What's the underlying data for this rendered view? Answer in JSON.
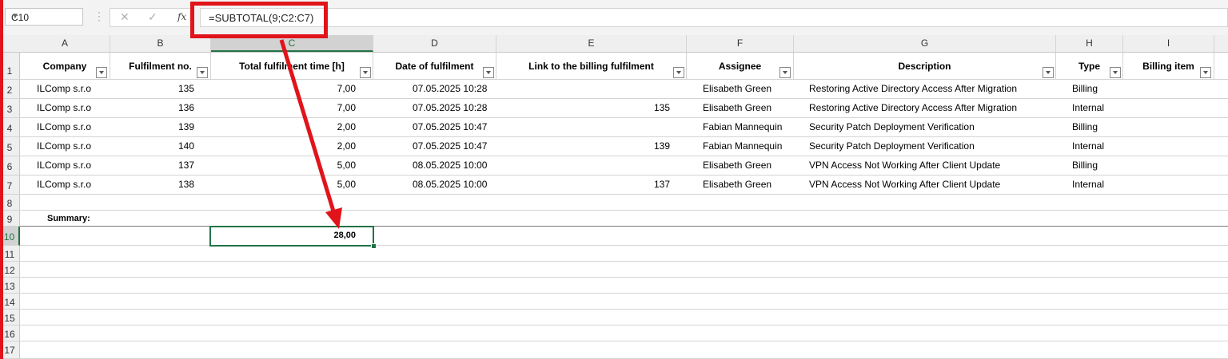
{
  "name_box": "C10",
  "formula": "=SUBTOTAL(9;C2:C7)",
  "columns": [
    "A",
    "B",
    "C",
    "D",
    "E",
    "F",
    "G",
    "H",
    "I"
  ],
  "selected_column": "C",
  "rows": [
    "1",
    "2",
    "3",
    "4",
    "5",
    "6",
    "7",
    "8",
    "9",
    "10",
    "11",
    "12",
    "13",
    "14",
    "15",
    "16",
    "17"
  ],
  "selected_row": "10",
  "headers": {
    "company": "Company",
    "fulfilment_no": "Fulfilment no.",
    "total_time": "Total fulfilment time [h]",
    "date": "Date of fulfilment",
    "link": "Link to the billing fulfilment",
    "assignee": "Assignee",
    "description": "Description",
    "type": "Type",
    "billing_item": "Billing item"
  },
  "records": [
    {
      "company": "ILComp s.r.o",
      "no": "135",
      "time": "7,00",
      "date": "07.05.2025 10:28",
      "link": "",
      "assignee": "Elisabeth Green",
      "description": "Restoring Active Directory Access After Migration",
      "type": "Billing"
    },
    {
      "company": "ILComp s.r.o",
      "no": "136",
      "time": "7,00",
      "date": "07.05.2025 10:28",
      "link": "135",
      "assignee": "Elisabeth Green",
      "description": "Restoring Active Directory Access After Migration",
      "type": "Internal"
    },
    {
      "company": "ILComp s.r.o",
      "no": "139",
      "time": "2,00",
      "date": "07.05.2025 10:47",
      "link": "",
      "assignee": "Fabian Mannequin",
      "description": "Security Patch Deployment Verification",
      "type": "Billing"
    },
    {
      "company": "ILComp s.r.o",
      "no": "140",
      "time": "2,00",
      "date": "07.05.2025 10:47",
      "link": "139",
      "assignee": "Fabian Mannequin",
      "description": "Security Patch Deployment Verification",
      "type": "Internal"
    },
    {
      "company": "ILComp s.r.o",
      "no": "137",
      "time": "5,00",
      "date": "08.05.2025 10:00",
      "link": "",
      "assignee": "Elisabeth Green",
      "description": "VPN Access Not Working After Client Update",
      "type": "Billing"
    },
    {
      "company": "ILComp s.r.o",
      "no": "138",
      "time": "5,00",
      "date": "08.05.2025 10:00",
      "link": "137",
      "assignee": "Elisabeth Green",
      "description": "VPN Access Not Working After Client Update",
      "type": "Internal"
    }
  ],
  "summary_label": "Summary:",
  "summary_value": "28,00",
  "colors": {
    "accent": "#217346",
    "callout": "#e0141a"
  }
}
